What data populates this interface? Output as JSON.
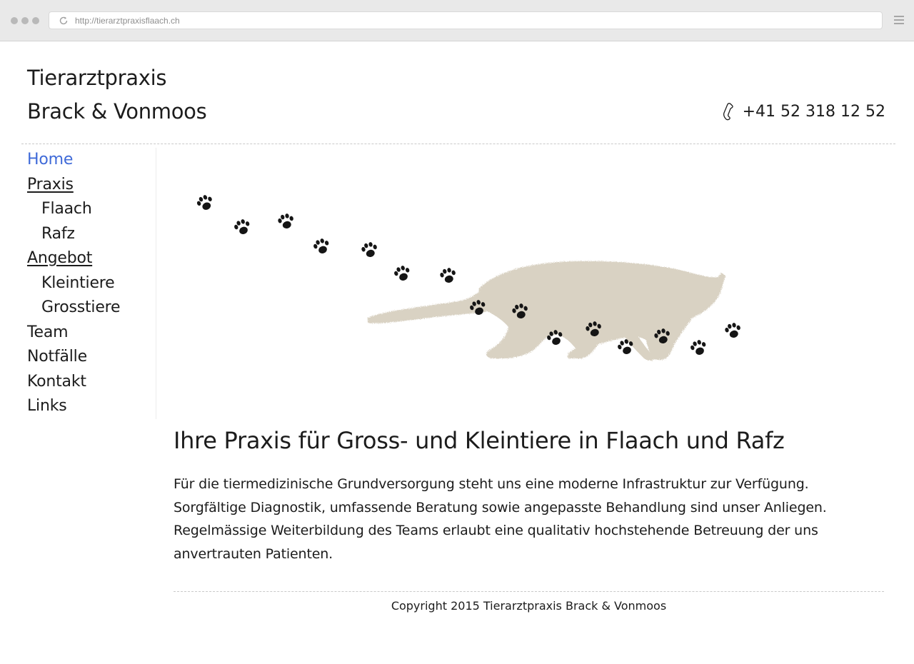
{
  "browser": {
    "url": "http://tierarztpraxisflaach.ch"
  },
  "header": {
    "title_line1": "Tierarztpraxis",
    "title_line2": "Brack & Vonmoos",
    "phone": "+41 52 318 12 52",
    "phone_icon": "phone-icon"
  },
  "nav": {
    "items": [
      {
        "label": "Home",
        "active": true
      },
      {
        "label": "Praxis"
      },
      {
        "label": "Flaach"
      },
      {
        "label": "Rafz"
      },
      {
        "label": "Angebot"
      },
      {
        "label": "Kleintiere"
      },
      {
        "label": "Grosstiere"
      },
      {
        "label": "Team"
      },
      {
        "label": "Notfälle"
      },
      {
        "label": "Kontakt"
      },
      {
        "label": "Links"
      }
    ]
  },
  "main": {
    "headline": "Ihre Praxis für Gross- und Kleintiere in Flaach und Rafz",
    "intro_lines": [
      "Für die tiermedizinische Grundversorgung steht uns eine moderne Infrastruktur zur Verfügung.",
      "Sorgfältige Diagnostik, umfassende Beratung sowie angepasste Behandlung sind unser Anliegen.",
      "Regelmässige Weiterbildung des Teams erlaubt eine qualitativ hochstehende Betreuung der uns",
      "anvertrauten Patienten."
    ]
  },
  "footer": {
    "copyright": "Copyright 2015 Tierarztpraxis Brack & Vonmoos"
  },
  "colors": {
    "link_active": "#3f6ad8",
    "text": "#1c1c1c",
    "cat_silhouette": "#d9d2c3",
    "paw": "#151515"
  }
}
